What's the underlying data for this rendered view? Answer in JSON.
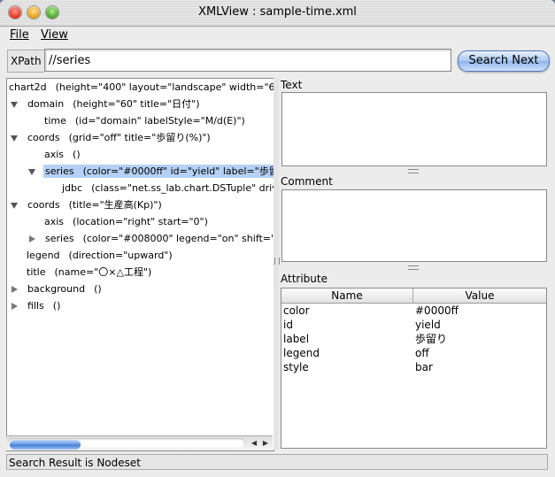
{
  "window": {
    "title": "XMLView : sample-time.xml"
  },
  "menu": {
    "file": "File",
    "view": "View"
  },
  "xpath": {
    "label": "XPath",
    "value": "//series",
    "search_button": "Search Next"
  },
  "tree": {
    "rows": [
      {
        "name": "chart2d",
        "attrs": "(height=\"400\" layout=\"landscape\" width=\"600",
        "toggle": "none",
        "depth": 0
      },
      {
        "name": "domain",
        "attrs": "(height=\"60\" title=\"日付\")",
        "toggle": "down",
        "depth": 0
      },
      {
        "name": "time",
        "attrs": "(id=\"domain\" labelStyle=\"M/d(E)\")",
        "toggle": "none",
        "depth": 1
      },
      {
        "name": "coords",
        "attrs": "(grid=\"off\" title=\"歩留り(%)\")",
        "toggle": "down",
        "depth": 0
      },
      {
        "name": "axis",
        "attrs": "()",
        "toggle": "none",
        "depth": 1
      },
      {
        "name": "series",
        "attrs": "(color=\"#0000ff\" id=\"yield\" label=\"歩留り",
        "toggle": "down",
        "depth": 1,
        "selected": true
      },
      {
        "name": "jdbc",
        "attrs": "(class=\"net.ss_lab.chart.DSTuple\" drive",
        "toggle": "none",
        "depth": 2
      },
      {
        "name": "coords",
        "attrs": "(title=\"生産高(Kp)\")",
        "toggle": "down",
        "depth": 0
      },
      {
        "name": "axis",
        "attrs": "(location=\"right\" start=\"0\")",
        "toggle": "none",
        "depth": 1
      },
      {
        "name": "series",
        "attrs": "(color=\"#008000\" legend=\"on\" shift=\"2\"",
        "toggle": "right",
        "depth": 1
      },
      {
        "name": "legend",
        "attrs": "(direction=\"upward\")",
        "toggle": "none",
        "depth": 0
      },
      {
        "name": "title",
        "attrs": "(name=\"〇×△工程\")",
        "toggle": "none",
        "depth": 0
      },
      {
        "name": "background",
        "attrs": "()",
        "toggle": "right",
        "depth": 0
      },
      {
        "name": "fills",
        "attrs": "()",
        "toggle": "right",
        "depth": 0
      }
    ]
  },
  "panels": {
    "text_label": "Text",
    "comment_label": "Comment",
    "attribute_label": "Attribute"
  },
  "attributes": {
    "col_name": "Name",
    "col_value": "Value",
    "rows": [
      {
        "name": "color",
        "value": "#0000ff"
      },
      {
        "name": "id",
        "value": "yield"
      },
      {
        "name": "label",
        "value": "歩留り"
      },
      {
        "name": "legend",
        "value": "off"
      },
      {
        "name": "style",
        "value": "bar"
      }
    ]
  },
  "status": {
    "text": "Search Result is Nodeset"
  },
  "colors": {
    "selection": "#b5d1f5",
    "accent": "#5f95e2"
  }
}
